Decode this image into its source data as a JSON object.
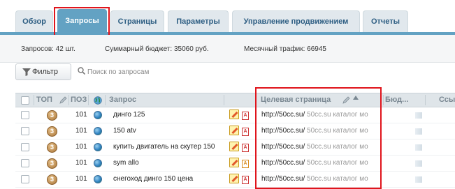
{
  "tabs": [
    {
      "label": "Обзор",
      "active": false
    },
    {
      "label": "Запросы",
      "active": true
    },
    {
      "label": "Страницы",
      "active": false
    },
    {
      "label": "Параметры",
      "active": false
    },
    {
      "label": "Управление продвижением",
      "active": false
    },
    {
      "label": "Отчеты",
      "active": false
    }
  ],
  "stats": {
    "queries": "Запросов: 42 шт.",
    "budget": "Суммарный бюджет: 35060 руб.",
    "traffic": "Месячный трафик: 66945"
  },
  "toolbar": {
    "filter_label": "Фильтр",
    "search_placeholder": "Поиск по запросам"
  },
  "grid": {
    "columns": {
      "top": "ТОП",
      "pos": "ПОЗ",
      "query": "Запрос",
      "target": "Целевая страница",
      "budget": "Бюд...",
      "links": "Ссы"
    },
    "rows": [
      {
        "top": "3",
        "pos": "101",
        "query": "динго 125",
        "url": "http://50cc.su/",
        "title": "50cc.su каталог мо",
        "doc": "A",
        "doc_color": "red"
      },
      {
        "top": "3",
        "pos": "101",
        "query": "150 atv",
        "url": "http://50cc.su/",
        "title": "50cc.su каталог мо",
        "doc": "A",
        "doc_color": "red"
      },
      {
        "top": "3",
        "pos": "101",
        "query": "купить двигатель на скутер 150",
        "url": "http://50cc.su/",
        "title": "50cc.su каталог мо",
        "doc": "A",
        "doc_color": "red"
      },
      {
        "top": "3",
        "pos": "101",
        "query": "sym allo",
        "url": "http://50cc.su/",
        "title": "50cc.su каталог мо",
        "doc": "A",
        "doc_color": "orange"
      },
      {
        "top": "3",
        "pos": "101",
        "query": "снегоход динго 150 цена",
        "url": "http://50cc.su/",
        "title": "50cc.su каталог мо",
        "doc": "A",
        "doc_color": "red"
      }
    ]
  },
  "colors": {
    "accent": "#63a2c3",
    "tab_text": "#2c5d82",
    "highlight": "#e0141c"
  },
  "icons": {
    "filter": "funnel-icon",
    "search": "search-icon",
    "edit": "pencil-icon",
    "sort": "sort-up-icon",
    "engine": "globe-icon"
  }
}
